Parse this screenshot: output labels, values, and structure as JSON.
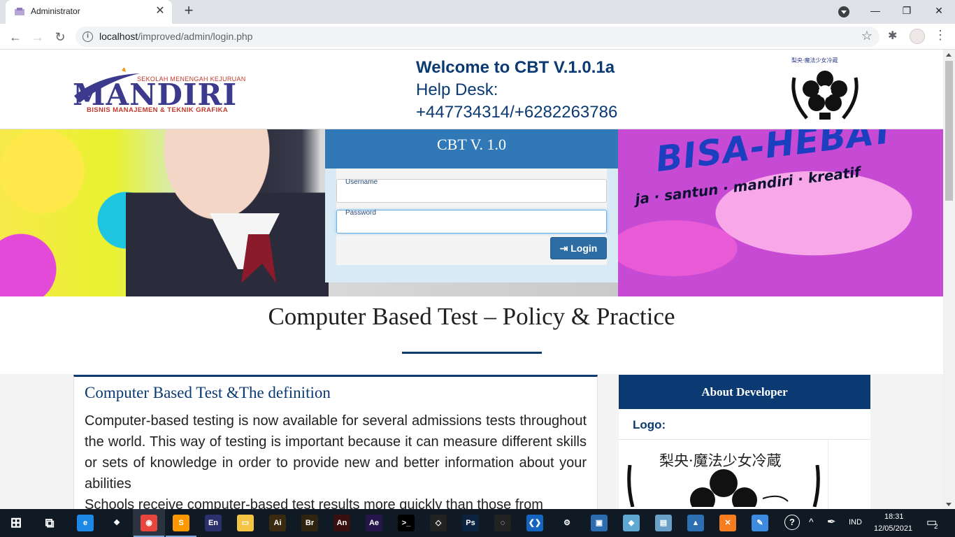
{
  "browser": {
    "tab_title": "Administrator",
    "url_host": "localhost",
    "url_path": "/improved/admin/login.php",
    "close_glyph": "✕",
    "new_tab_glyph": "+",
    "window_min": "—",
    "window_max": "❐",
    "window_close": "✕",
    "back_glyph": "←",
    "forward_glyph": "→",
    "reload_glyph": "↻",
    "info_glyph": "i",
    "star_glyph": "☆",
    "ext_glyph": "✱",
    "menu_glyph": "⋮"
  },
  "header": {
    "logo_small": "SEKOLAH MENENGAH KEJURUAN",
    "logo_big": "MANDIRI",
    "logo_sub": "BISNIS MANAJEMEN & TEKNIK GRAFIKA",
    "welcome_line1": "Welcome to CBT V.1.0.1a",
    "welcome_line2": "Help Desk:",
    "welcome_line3": "+447734314/+6282263786",
    "right_logo_caption": "梨央·魔法少女冷蔵"
  },
  "hero": {
    "slogan_big": "BISA-HEBAT",
    "slogan_small": "ja · santun · mandiri · kreatif"
  },
  "login": {
    "title": "CBT V. 1.0",
    "username_label": "Username",
    "password_label": "Password",
    "login_glyph": "⇥",
    "login_label": "Login"
  },
  "policy": {
    "title": "Computer Based Test – Policy & Practice"
  },
  "definition": {
    "title": "Computer Based Test &The definition",
    "paragraph1": "Computer-based testing is now available for several admissions tests throughout the world. This way of testing is important because it can measure different skills or sets of knowledge in order to provide new and better information about your abilities",
    "paragraph2": "Schools receive computer-based test results more quickly than those from"
  },
  "about": {
    "header": "About Developer",
    "logo_label": "Logo:",
    "logo_caption": "梨央·魔法少女冷蔵"
  },
  "taskbar": {
    "apps": [
      {
        "name": "edge",
        "label": "e",
        "color": "#1e88e5"
      },
      {
        "name": "dropbox",
        "label": "❖",
        "color": "#0f1a24"
      },
      {
        "name": "chrome",
        "label": "◉",
        "color": "#e8453c"
      },
      {
        "name": "sublime",
        "label": "S",
        "color": "#ff9800"
      },
      {
        "name": "encore",
        "label": "En",
        "color": "#2b2f6b"
      },
      {
        "name": "explorer",
        "label": "▭",
        "color": "#f4c542"
      },
      {
        "name": "illustrator",
        "label": "Ai",
        "color": "#3a2a10"
      },
      {
        "name": "bridge",
        "label": "Br",
        "color": "#2e2410"
      },
      {
        "name": "animate",
        "label": "An",
        "color": "#3a0f0f"
      },
      {
        "name": "after-effects",
        "label": "Ae",
        "color": "#24164a"
      },
      {
        "name": "terminal",
        "label": ">_",
        "color": "#000000"
      },
      {
        "name": "unity",
        "label": "◇",
        "color": "#222222"
      },
      {
        "name": "photoshop",
        "label": "Ps",
        "color": "#0b2240"
      },
      {
        "name": "line",
        "label": "◌",
        "color": "#222222"
      },
      {
        "name": "vscode",
        "label": "❮❯",
        "color": "#1565c0"
      },
      {
        "name": "settings",
        "label": "⚙",
        "color": "#0f1a24"
      },
      {
        "name": "app1",
        "label": "▣",
        "color": "#2b6cb0"
      },
      {
        "name": "app2",
        "label": "◆",
        "color": "#5fa8d3"
      },
      {
        "name": "app3",
        "label": "▤",
        "color": "#6aa0c8"
      },
      {
        "name": "photos",
        "label": "▲",
        "color": "#2d6fb3"
      },
      {
        "name": "xampp",
        "label": "✕",
        "color": "#f57c1f"
      },
      {
        "name": "paint",
        "label": "✎",
        "color": "#3d8be0"
      }
    ],
    "lang": "IND",
    "time": "18:31",
    "date": "12/05/2021",
    "notif_count": "2",
    "help_glyph": "?",
    "caret_glyph": "^",
    "pen_glyph": "✒",
    "notif_glyph": "▭",
    "start_glyph": "⊞",
    "taskview_glyph": "⧉"
  }
}
